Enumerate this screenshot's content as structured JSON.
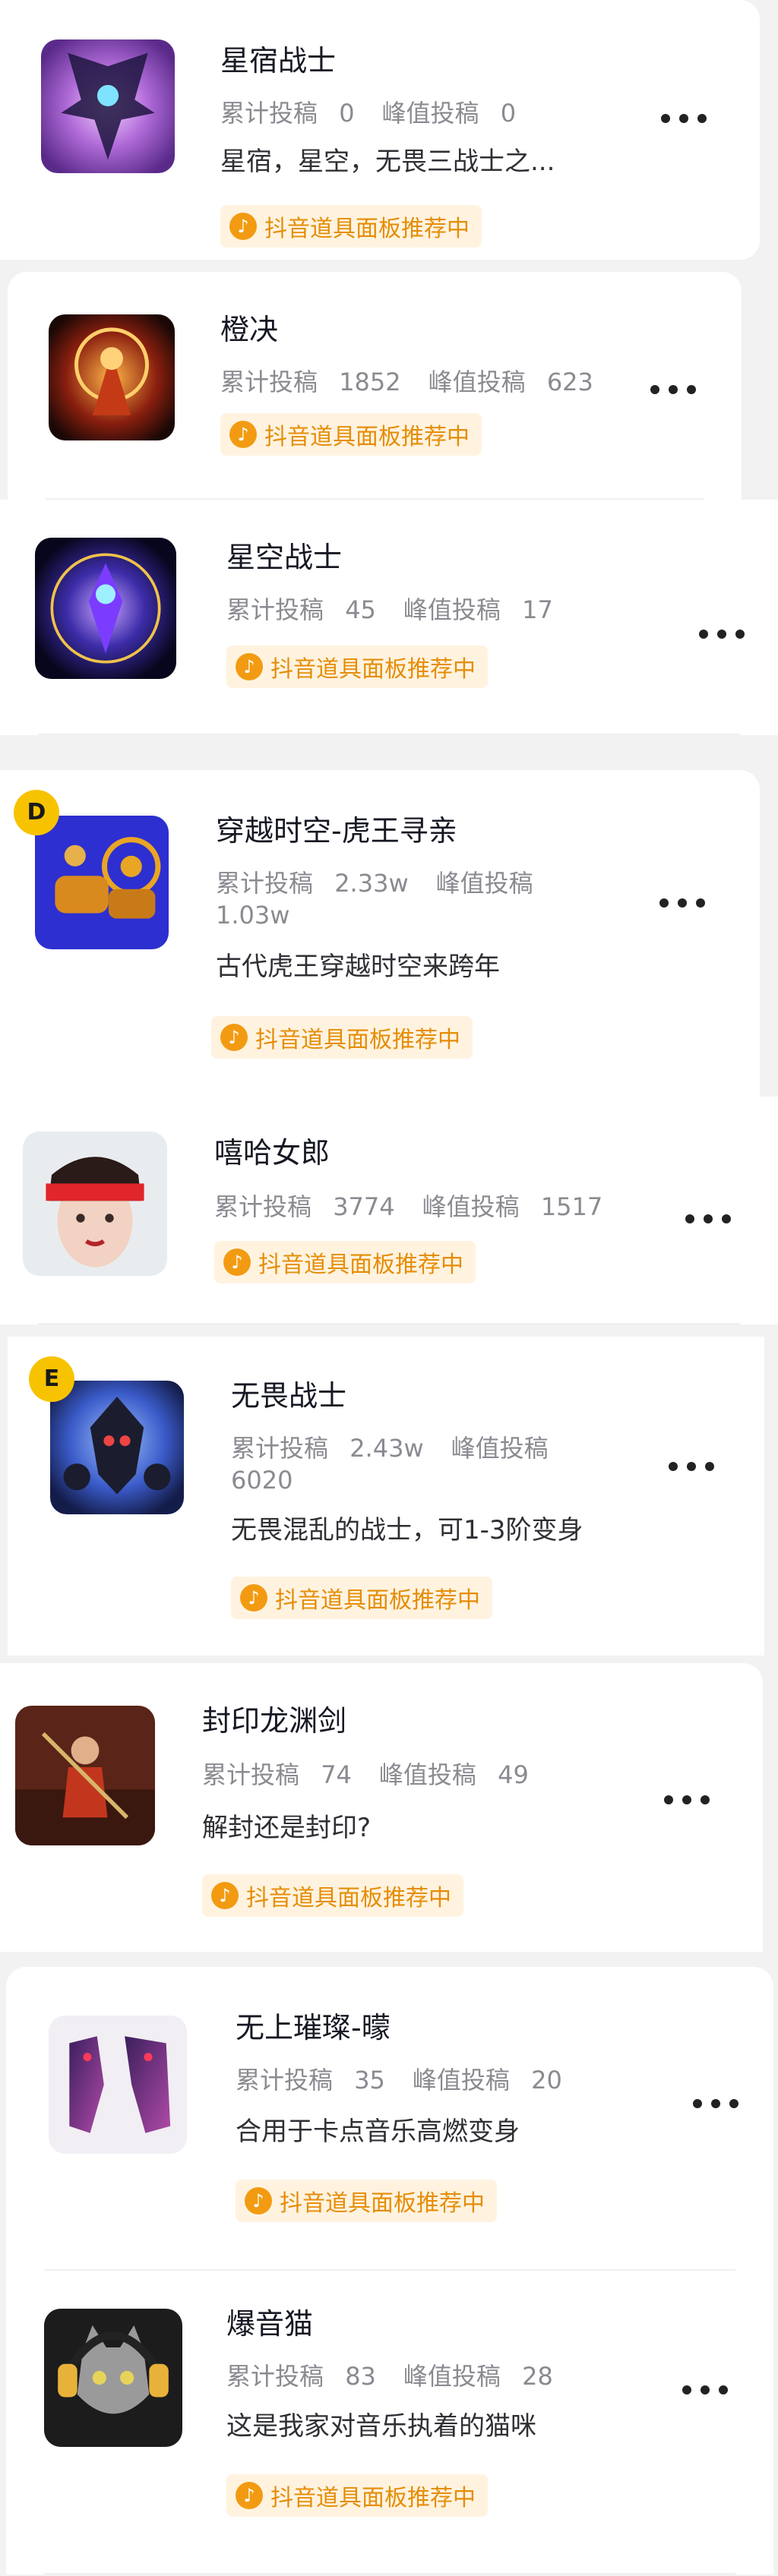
{
  "stat_labels": {
    "total": "累计投稿",
    "peak": "峰值投稿"
  },
  "tag_label": "抖音道具面板推荐中",
  "items": [
    {
      "title": "星宿战士",
      "total": "0",
      "peak": "0",
      "desc": "星宿，星空，无畏三战士之...",
      "badge": ""
    },
    {
      "title": "橙决",
      "total": "1852",
      "peak": "623",
      "desc": "",
      "badge": ""
    },
    {
      "title": "星空战士",
      "total": "45",
      "peak": "17",
      "desc": "",
      "badge": ""
    },
    {
      "title": "穿越时空-虎王寻亲",
      "total": "2.33w",
      "peak": "1.03w",
      "desc": "古代虎王穿越时空来跨年",
      "badge": "D"
    },
    {
      "title": "嘻哈女郎",
      "total": "3774",
      "peak": "1517",
      "desc": "",
      "badge": ""
    },
    {
      "title": "无畏战士",
      "total": "2.43w",
      "peak": "6020",
      "desc": "无畏混乱的战士，可1-3阶变身",
      "badge": "E"
    },
    {
      "title": "封印龙渊剑",
      "total": "74",
      "peak": "49",
      "desc": "解封还是封印?",
      "badge": ""
    },
    {
      "title": "无上璀璨-曚",
      "total": "35",
      "peak": "20",
      "desc": "合用于卡点音乐高燃变身",
      "badge": ""
    },
    {
      "title": "爆音猫",
      "total": "83",
      "peak": "28",
      "desc": "这是我家对音乐执着的猫咪",
      "badge": ""
    }
  ]
}
